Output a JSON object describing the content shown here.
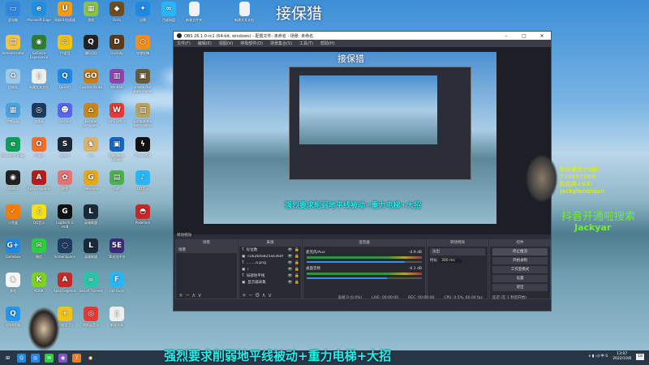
{
  "watermark": "接保猎",
  "desktop_icons": [
    {
      "label": "此电脑",
      "color": "#2e86de",
      "glyph": "▭"
    },
    {
      "label": "Microsoft Edge",
      "color": "#1f8fe0",
      "glyph": "e"
    },
    {
      "label": "网易UU加速器",
      "color": "#f39c12",
      "glyph": "U"
    },
    {
      "label": "游戏",
      "color": "#8bc34a",
      "glyph": "▦"
    },
    {
      "label": "Dota",
      "color": "#6d4c1f",
      "glyph": "◆"
    },
    {
      "label": "迅雷",
      "color": "#1e88e5",
      "glyph": "✦"
    },
    {
      "label": "百度网盘",
      "color": "#29b6f6",
      "glyph": "∞"
    },
    {
      "label": "Administrator",
      "color": "#f5c542",
      "glyph": "▤"
    },
    {
      "label": "GeForce Experience",
      "color": "#2e7d32",
      "glyph": "◉"
    },
    {
      "label": "YY语音",
      "color": "#f1c40f",
      "glyph": "☺"
    },
    {
      "label": "腾讯QQ",
      "color": "#222",
      "glyph": "Q"
    },
    {
      "label": "Divinity",
      "color": "#5d3a1a",
      "glyph": "D"
    },
    {
      "label": "守望先锋",
      "color": "#ef8f1e",
      "glyph": "○"
    },
    {
      "label": "回收站",
      "color": "#9ec9e8",
      "glyph": "♻"
    },
    {
      "label": "新建文本文档",
      "color": "#eeeeee",
      "glyph": "▯"
    },
    {
      "label": "QuickQ",
      "color": "#1e88e5",
      "glyph": "Q"
    },
    {
      "label": "Counter-Strike",
      "color": "#c77d1a",
      "glyph": "GO"
    },
    {
      "label": "WinRAR",
      "color": "#8e44ad",
      "glyph": "▥"
    },
    {
      "label": "Inside the Backrooms",
      "color": "#6b5a3a",
      "glyph": "▣"
    },
    {
      "label": "控制面板",
      "color": "#4aa3df",
      "glyph": "▦"
    },
    {
      "label": "加速器",
      "color": "#1c3a5e",
      "glyph": "◎"
    },
    {
      "label": "Discord",
      "color": "#5865f2",
      "glyph": "☻"
    },
    {
      "label": "Escape Simulator",
      "color": "#c7861b",
      "glyph": "⌂"
    },
    {
      "label": "WPS Office",
      "color": "#e53935",
      "glyph": "W"
    },
    {
      "label": "Escape the Backrooms",
      "color": "#b9a35b",
      "glyph": "▧"
    },
    {
      "label": "Microsoft Edge",
      "color": "#0f9d58",
      "glyph": "e"
    },
    {
      "label": "Origin",
      "color": "#f56c2d",
      "glyph": "O"
    },
    {
      "label": "Steam",
      "color": "#1b2838",
      "glyph": "S"
    },
    {
      "label": "nn",
      "color": "#d9b36b",
      "glyph": "♞"
    },
    {
      "label": "Wallpaper Engine",
      "color": "#1565c0",
      "glyph": "▣"
    },
    {
      "label": "Thronefall",
      "color": "#111",
      "glyph": "ϟ"
    },
    {
      "label": "obs64",
      "color": "#222",
      "glyph": "◉"
    },
    {
      "label": "Apex Legends",
      "color": "#b71c1c",
      "glyph": "A"
    },
    {
      "label": "视频",
      "color": "#e57373",
      "glyph": "✿"
    },
    {
      "label": "WeGame",
      "color": "#e6a817",
      "glyph": "G"
    },
    {
      "label": "Raft",
      "color": "#4caf50",
      "glyph": "▤"
    },
    {
      "label": "QQ音乐",
      "color": "#29b6f6",
      "glyph": "♪"
    },
    {
      "label": "小黑盒",
      "color": "#f57c00",
      "glyph": "✓"
    },
    {
      "label": "QQ音乐",
      "color": "#f4e01a",
      "glyph": "♫"
    },
    {
      "label": "Logitech G HUB",
      "color": "#111",
      "glyph": "G"
    },
    {
      "label": "英雄联盟",
      "color": "#1a2a3a",
      "glyph": "L"
    },
    {
      "label": "",
      "color": "transparent",
      "glyph": ""
    },
    {
      "label": "Pokemon",
      "color": "#c62828",
      "glyph": "◓"
    },
    {
      "label": "Gamebox",
      "color": "#1e88e5",
      "glyph": "G+"
    },
    {
      "label": "微信",
      "color": "#2ecc40",
      "glyph": "✉"
    },
    {
      "label": "ScreenSpace",
      "color": "#1e3a5e",
      "glyph": "◌"
    },
    {
      "label": "英雄联盟",
      "color": "#1a2a3a",
      "glyph": "L"
    },
    {
      "label": "5E对战平台",
      "color": "#3b2a7a",
      "glyph": "5E"
    },
    {
      "label": "",
      "color": "transparent",
      "glyph": ""
    },
    {
      "label": "咪咕",
      "color": "#f5f5f5",
      "glyph": "♞"
    },
    {
      "label": "KOOK",
      "color": "#7cd321",
      "glyph": "K"
    },
    {
      "label": "Apex Legends",
      "color": "#c62828",
      "glyph": "A"
    },
    {
      "label": "Sea of Thieves",
      "color": "#26c6a8",
      "glyph": "☠"
    },
    {
      "label": "Fall Guys",
      "color": "#29b6f6",
      "glyph": "F"
    },
    {
      "label": "",
      "color": "transparent",
      "glyph": ""
    },
    {
      "label": "QQ浏览器",
      "color": "#2196f3",
      "glyph": "Q"
    },
    {
      "label": "",
      "color": "transparent",
      "glyph": ""
    },
    {
      "label": "360安全卫士",
      "color": "#f1c40f",
      "glyph": "+"
    },
    {
      "label": "网易云音乐",
      "color": "#e53935",
      "glyph": "◎"
    },
    {
      "label": "新建文本",
      "color": "#eeeeee",
      "glyph": "▯"
    },
    {
      "label": "",
      "color": "transparent",
      "glyph": ""
    }
  ],
  "top_files": [
    "新建文件夹",
    "新建文本文档"
  ],
  "obs": {
    "title": "OBS 26.1.0-rc1 (64-bit, windows) - 配置文件: 未命名 - 场景: 未命名",
    "menu": [
      "文件(F)",
      "编辑(E)",
      "视图(V)",
      "停靠部件(D)",
      "场景集合(S)",
      "工具(T)",
      "帮助(H)"
    ],
    "preview_watermark": "接保猎",
    "preview_caption": "强烈要求削弱地平线被动+重力电梯+大招",
    "scene_transition_label": "转场特效",
    "docks": {
      "scenes": {
        "title": "场景",
        "items": [
          "场景"
        ]
      },
      "sources": {
        "title": "来源",
        "items": [
          "标位数",
          "cu62b4a825a4364f",
          "........a.png",
          "i",
          "局部地平线",
          "显示器采集"
        ]
      },
      "mixer": {
        "title": "混音器",
        "channels": [
          {
            "name": "麦克风/Aux",
            "db": "-4.9 dB",
            "volume": 0.85
          },
          {
            "name": "桌面音频",
            "db": "-6.1 dB",
            "volume": 0.7
          }
        ]
      },
      "transitions": {
        "title": "转场特效",
        "type": "淡出",
        "duration_label": "时长",
        "duration": "300 ms"
      },
      "controls": {
        "title": "控件",
        "buttons": [
          "停止推流",
          "开始录制",
          "工作室模式",
          "设置",
          "退出"
        ]
      }
    },
    "status": {
      "drop": "丢帧 0 (0.0%)",
      "live": "LIVE: 00:00:00",
      "rec": "REC: 00:00:00",
      "cpu": "CPU: 0.5%, 60.00 fps",
      "delay": "延迟 (在 1 秒后开始)"
    }
  },
  "overlay": {
    "promo_lines": [
      "粉丝拿号+Q群:",
      "716837959",
      "粉丝群+VX:",
      "jackyfensiqun"
    ],
    "douyin": "抖音开通啦搜索",
    "name": "Jackyar"
  },
  "caption": "强烈要求削弱地平线被动+重力电梯+大招",
  "taskbar": {
    "time": "13:07",
    "date": "2022/10/6",
    "notify_count": "18"
  }
}
